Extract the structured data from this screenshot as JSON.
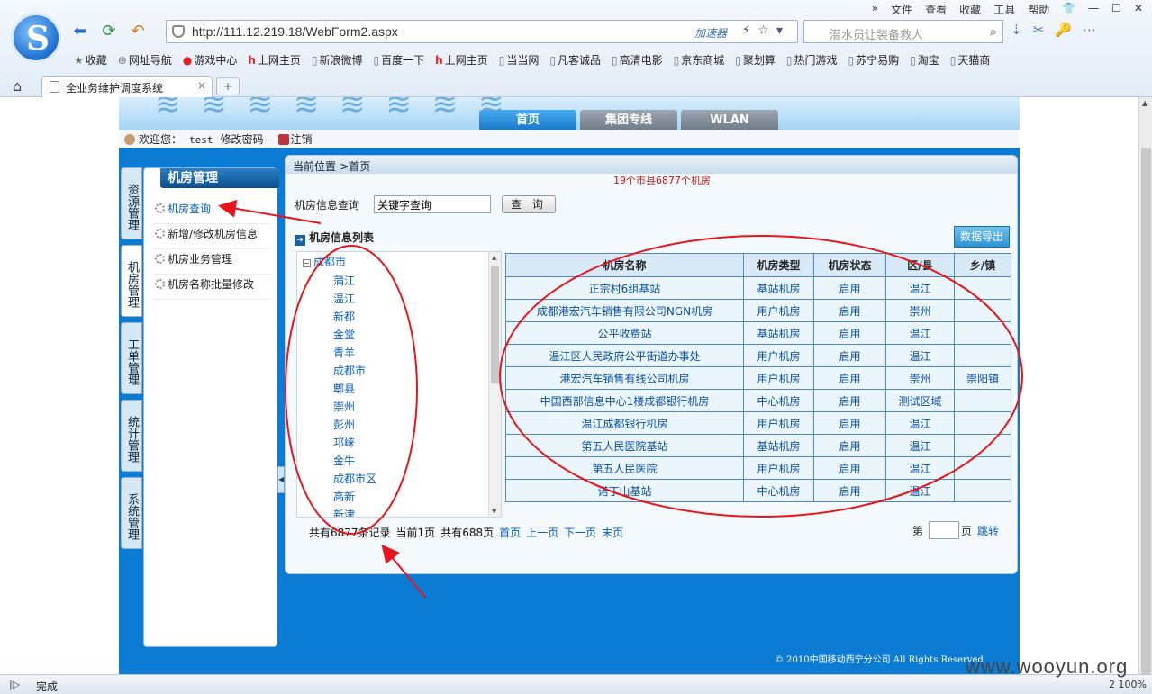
{
  "browser": {
    "menu": [
      "»",
      "文件",
      "查看",
      "收藏",
      "工具",
      "帮助"
    ],
    "url": "http://111.12.219.18/WebForm2.aspx",
    "accelerator": "加速器",
    "search_placeholder": "潜水员让装备救人",
    "favorites": [
      {
        "label": "收藏",
        "icon": "star-icon"
      },
      {
        "label": "网址导航",
        "icon": "globe-icon"
      },
      {
        "label": "游戏中心",
        "icon": "game-icon"
      },
      {
        "label": "上网主页",
        "icon": "hao-icon"
      },
      {
        "label": "新浪微博",
        "icon": "page-icon"
      },
      {
        "label": "百度一下",
        "icon": "page-icon"
      },
      {
        "label": "上网主页",
        "icon": "hao-icon"
      },
      {
        "label": "当当网",
        "icon": "page-icon"
      },
      {
        "label": "凡客诚品",
        "icon": "page-icon"
      },
      {
        "label": "高清电影",
        "icon": "page-icon"
      },
      {
        "label": "京东商城",
        "icon": "page-icon"
      },
      {
        "label": "聚划算",
        "icon": "page-icon"
      },
      {
        "label": "热门游戏",
        "icon": "page-icon"
      },
      {
        "label": "苏宁易购",
        "icon": "page-icon"
      },
      {
        "label": "淘宝",
        "icon": "page-icon"
      },
      {
        "label": "天猫商",
        "icon": "page-icon"
      }
    ],
    "tab_title": "全业务维护调度系统",
    "status_text": "完成",
    "status_right": "2 100%"
  },
  "header": {
    "nav_tabs": [
      {
        "label": "首页",
        "active": true
      },
      {
        "label": "集团专线",
        "active": false
      },
      {
        "label": "WLAN",
        "active": false
      }
    ],
    "welcome": "欢迎您：",
    "username": "test",
    "change_password": "修改密码",
    "logout": "注销"
  },
  "side_tabs": [
    "资源管理",
    "机房管理",
    "工单管理",
    "统计管理",
    "系统管理"
  ],
  "left_panel": {
    "title": "机房管理",
    "items": [
      "机房查询",
      "新增/修改机房信息",
      "机房业务管理",
      "机房名称批量修改"
    ]
  },
  "main": {
    "breadcrumb": "当前位置->首页",
    "count_info": "19个市县6877个机房",
    "query_label": "机房信息查询",
    "query_value": "关键字查询",
    "query_button": "查 询",
    "list_title": "机房信息列表",
    "export_button": "数据导出",
    "tree": {
      "root": "成都市",
      "children": [
        "蒲江",
        "温江",
        "新都",
        "金堂",
        "青羊",
        "成都市",
        "郫县",
        "崇州",
        "彭州",
        "邛崃",
        "金牛",
        "成都市区",
        "高新",
        "新津"
      ]
    },
    "table": {
      "headers": [
        "机房名称",
        "机房类型",
        "机房状态",
        "区/县",
        "乡/镇"
      ],
      "rows": [
        [
          "正宗村6组基站",
          "基站机房",
          "启用",
          "温江",
          ""
        ],
        [
          "成都港宏汽车销售有限公司NGN机房",
          "用户机房",
          "启用",
          "崇州",
          ""
        ],
        [
          "公平收费站",
          "基站机房",
          "启用",
          "温江",
          ""
        ],
        [
          "温江区人民政府公平街道办事处",
          "用户机房",
          "启用",
          "温江",
          ""
        ],
        [
          "港宏汽车销售有线公司机房",
          "用户机房",
          "启用",
          "崇州",
          "崇阳镇"
        ],
        [
          "中国西部信息中心1楼成都银行机房",
          "中心机房",
          "启用",
          "测试区域",
          ""
        ],
        [
          "温江成都银行机房",
          "用户机房",
          "启用",
          "温江",
          ""
        ],
        [
          "第五人民医院基站",
          "基站机房",
          "启用",
          "温江",
          ""
        ],
        [
          "第五人民医院",
          "用户机房",
          "启用",
          "温江",
          ""
        ],
        [
          "诺丁山基站",
          "中心机房",
          "启用",
          "温江",
          ""
        ]
      ]
    },
    "pager": {
      "total": "共有6877条记录",
      "current": "当前1页",
      "pages": "共有688页",
      "first": "首页",
      "prev": "上一页",
      "next": "下一页",
      "last": "末页",
      "page_prefix": "第",
      "page_suffix": "页",
      "jump": "跳转"
    },
    "copyright": "© 2010中国移动西宁分公司 All Rights Reserved"
  },
  "watermark": "www.wooyun.org",
  "colors": {
    "annotation": "#e8141b",
    "accent": "#0b7bd3"
  }
}
